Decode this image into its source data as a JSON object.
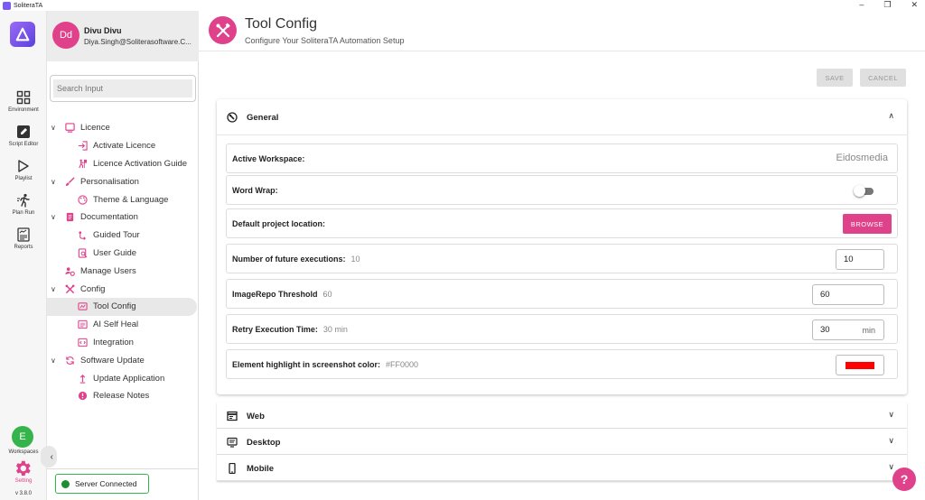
{
  "window": {
    "title": "SoliteraTA",
    "controls": [
      "–",
      "❐",
      "✕"
    ]
  },
  "rail": {
    "items": [
      {
        "label": "Environment",
        "icon": "grid-icon"
      },
      {
        "label": "Script Editor",
        "icon": "edit-icon"
      },
      {
        "label": "Playlist",
        "icon": "play-icon"
      },
      {
        "label": "Plan Run",
        "icon": "run-icon"
      },
      {
        "label": "Reports",
        "icon": "report-icon"
      }
    ],
    "workspace_initial": "E",
    "workspace_label": "Workspaces",
    "setting_label": "Setting",
    "version": "v 3.8.0"
  },
  "profile": {
    "initials": "Dd",
    "name": "Divu Divu",
    "email": "Diya.Singh@Soliterasoftware.C..."
  },
  "search": {
    "placeholder": "Search Input"
  },
  "nav": {
    "licence": "Licence",
    "activate_licence": "Activate Licence",
    "licence_guide": "Licence Activation Guide",
    "personalisation": "Personalisation",
    "theme_language": "Theme & Language",
    "documentation": "Documentation",
    "guided_tour": "Guided Tour",
    "user_guide": "User Guide",
    "manage_users": "Manage Users",
    "config": "Config",
    "tool_config": "Tool Config",
    "ai_self_heal": "AI Self Heal",
    "integration": "Integration",
    "software_update": "Software Update",
    "update_application": "Update Application",
    "release_notes": "Release Notes"
  },
  "server_status": "Server Connected",
  "header": {
    "title": "Tool Config",
    "subtitle": "Configure Your SoliteraTA Automation Setup"
  },
  "actions": {
    "save": "SAVE",
    "cancel": "CANCEL"
  },
  "general": {
    "title": "General",
    "active_workspace_label": "Active Workspace:",
    "active_workspace_value": "Eidosmedia",
    "word_wrap_label": "Word Wrap:",
    "word_wrap_on": false,
    "default_location_label": "Default project location:",
    "browse": "BROWSE",
    "future_exec_label": "Number of future executions:",
    "future_exec_hint": "10",
    "future_exec_value": "10",
    "image_repo_label": "ImageRepo Threshold",
    "image_repo_hint": "60",
    "image_repo_value": "60",
    "retry_label": "Retry Execution Time:",
    "retry_hint": "30 min",
    "retry_value": "30",
    "retry_unit": "min",
    "highlight_label": "Element highlight in screenshot color:",
    "highlight_hint": "#FF0000",
    "highlight_color": "#FF0000"
  },
  "sections": {
    "web": "Web",
    "desktop": "Desktop",
    "mobile": "Mobile"
  },
  "colors": {
    "accent": "#E0418B",
    "brand": "#6B4EE6",
    "success": "#34B44A"
  },
  "help": "?"
}
